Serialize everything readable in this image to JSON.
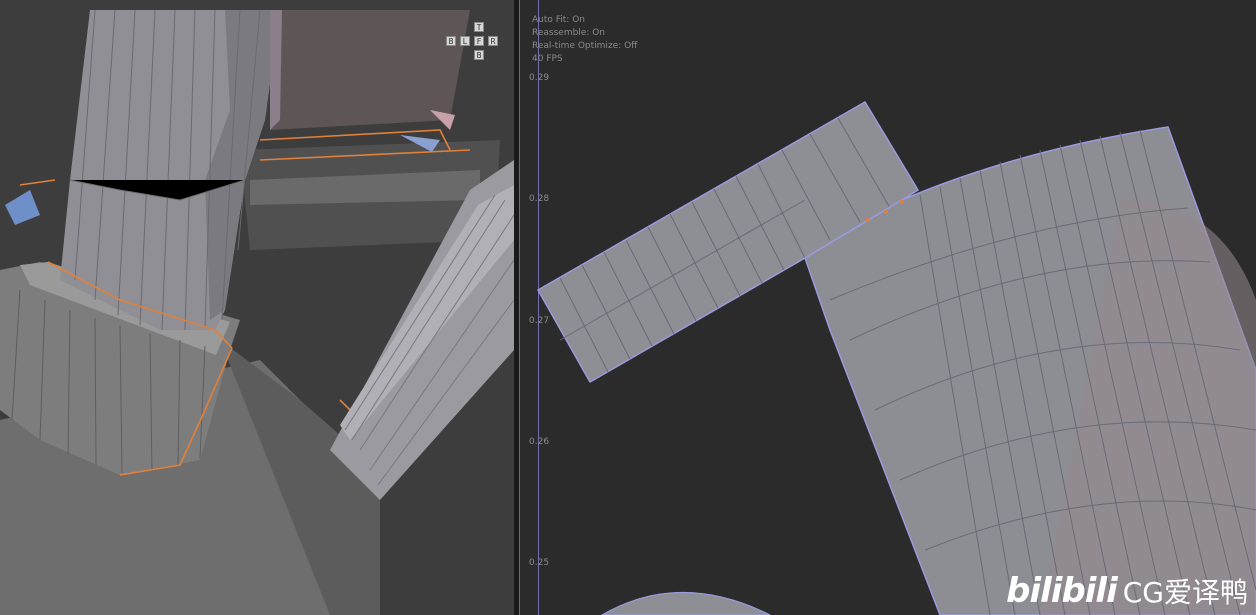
{
  "nav_cube": {
    "top": "T",
    "back": "B",
    "left": "L",
    "front": "F",
    "right": "R",
    "bottom": "B"
  },
  "uv_overlay": {
    "stats": [
      "Auto Fit: On",
      "Reassemble: On",
      "Real-time Optimize: Off",
      "40 FPS"
    ]
  },
  "ruler": {
    "ticks": [
      "0.29",
      "0.28",
      "0.27",
      "0.26",
      "0.25"
    ]
  },
  "watermark": {
    "logo": "bilibili",
    "text": "CG爱译鸭"
  },
  "colors": {
    "mesh": "#8f8f95",
    "edge": "#5a5a62",
    "selection": "#e0803a",
    "uv_border": "#9a9adf",
    "uv_face": "#8d8d94",
    "background_uv": "#2b2b2b",
    "background_3d": "#3d3d3d"
  }
}
